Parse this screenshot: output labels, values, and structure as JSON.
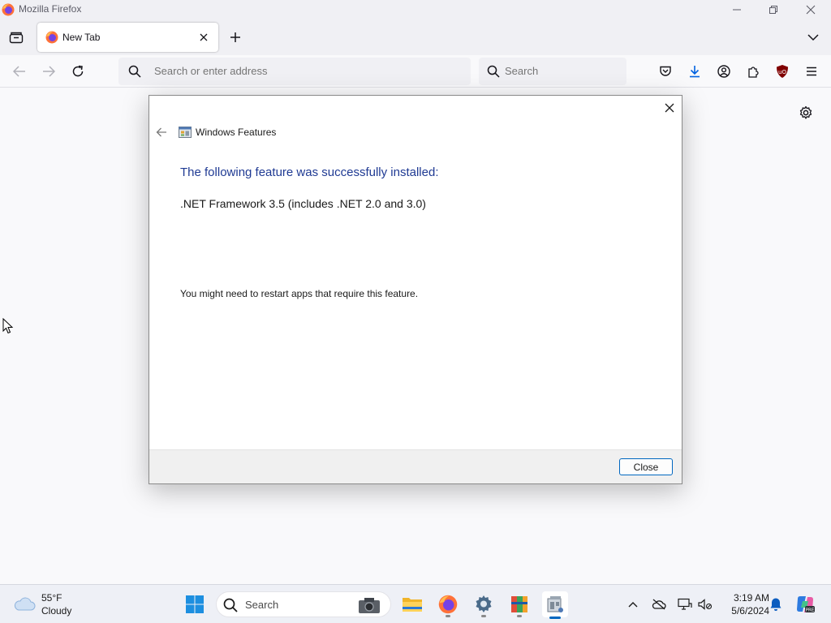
{
  "window": {
    "title": "Mozilla Firefox"
  },
  "tabs": [
    {
      "label": "New Tab",
      "active": true
    }
  ],
  "navbar": {
    "url_placeholder": "Search or enter address",
    "search_placeholder": "Search"
  },
  "toolbar_icons": [
    "pocket-icon",
    "downloads-icon",
    "account-icon",
    "extensions-icon",
    "ublock-icon",
    "menu-icon"
  ],
  "dialog": {
    "title": "Windows Features",
    "heading": "The following feature was successfully installed:",
    "feature": ".NET Framework 3.5 (includes .NET 2.0 and 3.0)",
    "note": "You might need to restart apps that require this feature.",
    "close_button": "Close"
  },
  "taskbar": {
    "weather": {
      "temp": "55°F",
      "condition": "Cloudy"
    },
    "search_label": "Search",
    "apps": [
      "start",
      "search",
      "file-explorer",
      "firefox",
      "settings",
      "winrar",
      "optional-features"
    ],
    "clock": {
      "time": "3:19 AM",
      "date": "5/6/2024"
    }
  },
  "colors": {
    "accent": "#0067c0",
    "dialog_heading": "#1f3a93",
    "chrome": "#f0f0f4"
  }
}
